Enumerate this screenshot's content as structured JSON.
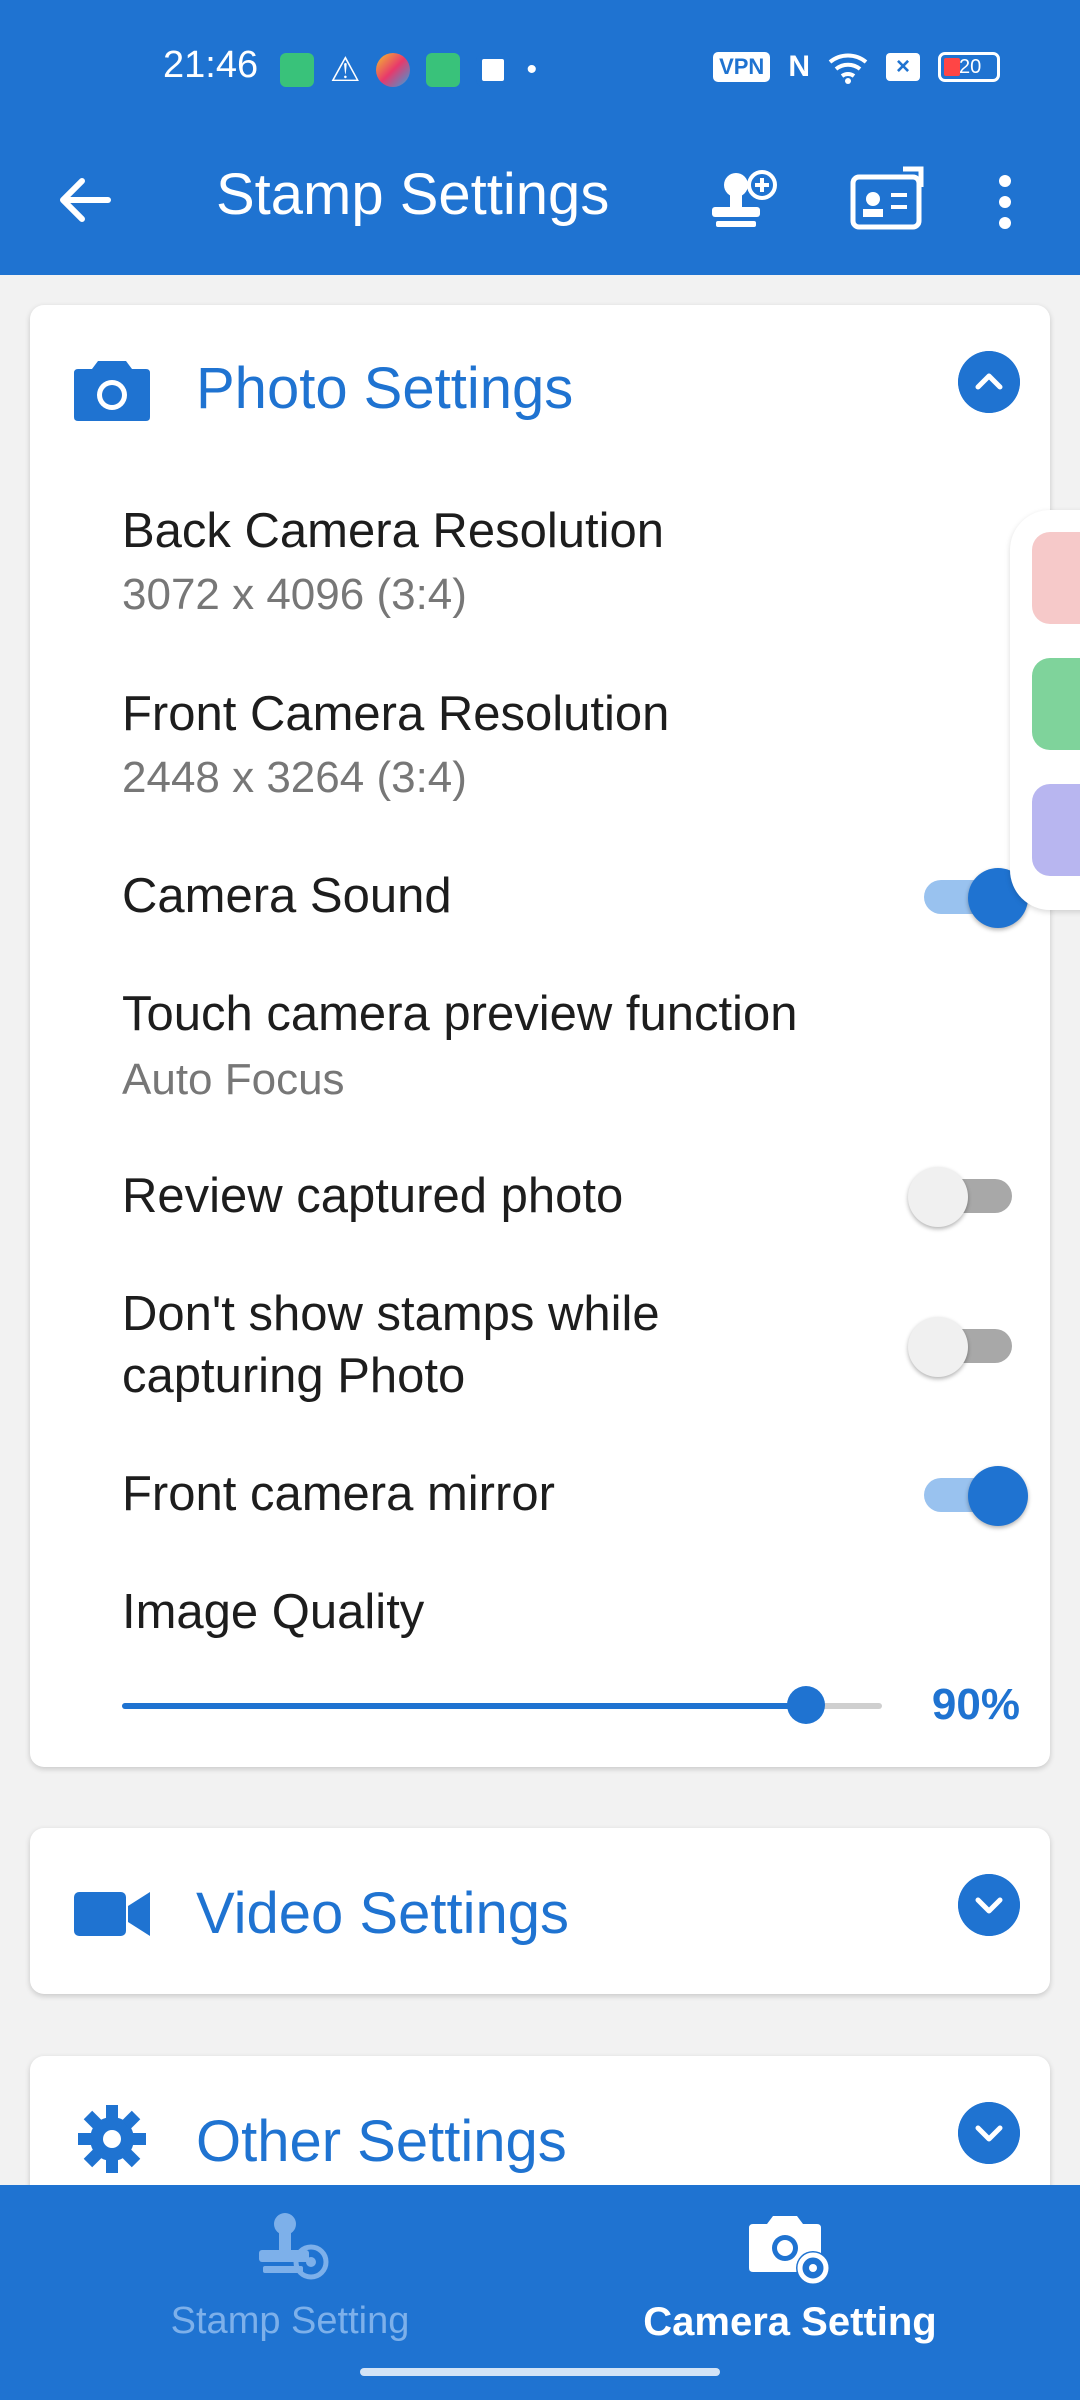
{
  "status_bar": {
    "time": "21:46",
    "vpn": "VPN",
    "battery": "20"
  },
  "app_bar": {
    "title": "Stamp Settings"
  },
  "photo_settings": {
    "title": "Photo Settings",
    "rows": {
      "back_resolution": {
        "title": "Back Camera Resolution",
        "value": "3072 x 4096 (3:4)"
      },
      "front_resolution": {
        "title": "Front Camera Resolution",
        "value": "2448 x 3264 (3:4)"
      },
      "camera_sound": {
        "title": "Camera Sound",
        "on": true
      },
      "touch_preview": {
        "title": "Touch camera preview function",
        "value": "Auto Focus"
      },
      "review_photo": {
        "title": "Review captured photo",
        "on": false
      },
      "hide_stamps": {
        "title": "Don't show stamps while capturing Photo",
        "on": false
      },
      "front_mirror": {
        "title": "Front camera mirror",
        "on": true
      },
      "image_quality": {
        "title": "Image Quality",
        "value_label": "90%",
        "value": 90
      }
    }
  },
  "video_settings": {
    "title": "Video Settings"
  },
  "other_settings": {
    "title": "Other Settings"
  },
  "bottom_nav": {
    "items": [
      {
        "label": "Stamp Setting",
        "active": false
      },
      {
        "label": "Camera Setting",
        "active": true
      }
    ]
  },
  "colors": {
    "primary": "#1f73d1",
    "inactive_nav": "#7db0ea"
  }
}
